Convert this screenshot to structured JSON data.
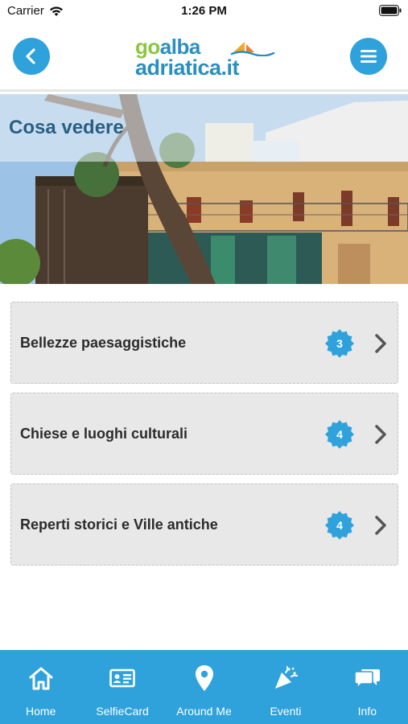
{
  "status_bar": {
    "carrier": "Carrier",
    "time": "1:26 PM"
  },
  "header": {
    "logo_go": "go",
    "logo_alba": "alba",
    "logo_line2": "adriatica.it",
    "back_icon": "chevron-left-icon",
    "menu_icon": "hamburger-menu-icon"
  },
  "hero": {
    "title": "Cosa vedere"
  },
  "categories": [
    {
      "label": "Bellezze paesaggistiche",
      "count": "3"
    },
    {
      "label": "Chiese e luoghi culturali",
      "count": "4"
    },
    {
      "label": "Reperti storici e Ville antiche",
      "count": "4"
    }
  ],
  "tabbar": {
    "tabs": [
      {
        "label": "Home",
        "icon": "home-icon"
      },
      {
        "label": "SelfieCard",
        "icon": "id-card-icon"
      },
      {
        "label": "Around Me",
        "icon": "location-pin-icon"
      },
      {
        "label": "Eventi",
        "icon": "party-popper-icon"
      },
      {
        "label": "Info",
        "icon": "chat-bubbles-icon"
      }
    ]
  },
  "colors": {
    "accent": "#2fa2dc",
    "hero_title": "#2a5f84",
    "list_background": "#e8e8e8",
    "badge": "#2fa2dc"
  }
}
